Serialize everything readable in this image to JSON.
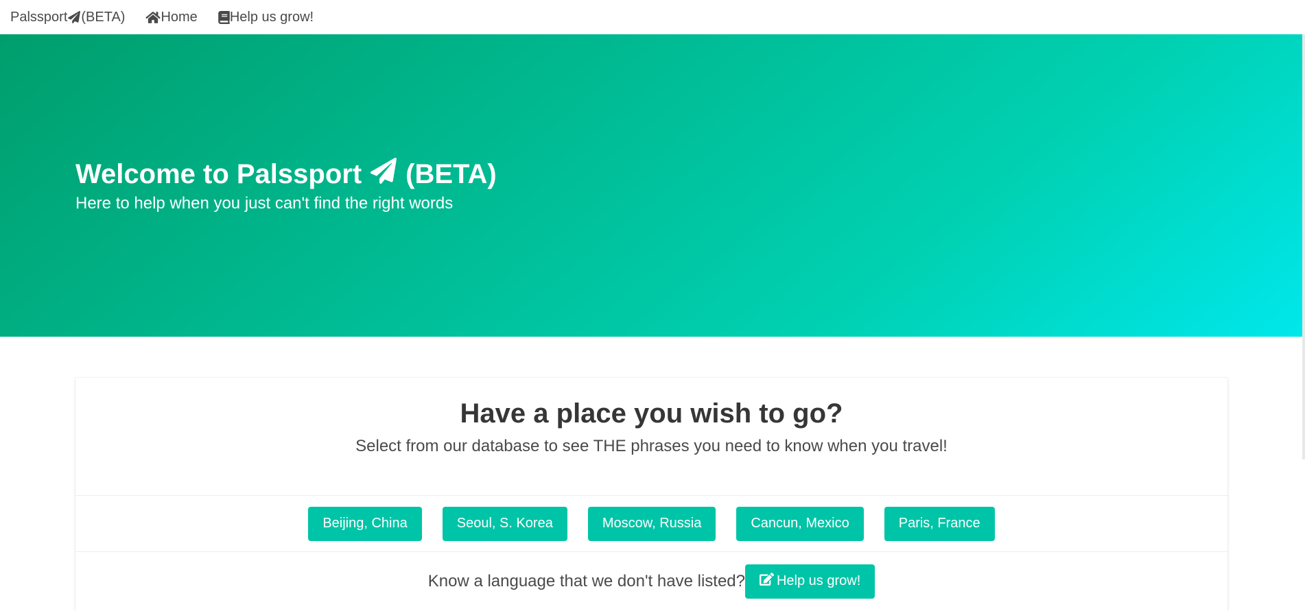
{
  "navbar": {
    "brand_prefix": "Palssport",
    "brand_suffix": "(BETA)",
    "home_label": "Home",
    "help_label": "Help us grow!"
  },
  "hero": {
    "title_prefix": "Welcome to Palssport",
    "title_suffix": "(BETA)",
    "subtitle": "Here to help when you just can't find the right words",
    "gradient_colors": [
      "#009e6c",
      "#00d1b2",
      "#00e7eb"
    ]
  },
  "card": {
    "title": "Have a place you wish to go?",
    "subtitle": "Select from our database to see THE phrases you need to know when you travel!",
    "cities": [
      {
        "label": "Beijing, China"
      },
      {
        "label": "Seoul, S. Korea"
      },
      {
        "label": "Moscow, Russia"
      },
      {
        "label": "Cancun, Mexico"
      },
      {
        "label": "Paris, France"
      }
    ],
    "help_prompt": "Know a language that we don't have listed?",
    "help_button_label": "Help us grow!"
  },
  "colors": {
    "accent": "#00c4a7",
    "text": "#363636"
  },
  "icons": {
    "brand": "paper-plane-icon",
    "home": "home-icon",
    "help": "book-icon",
    "help_button": "edit-icon"
  }
}
